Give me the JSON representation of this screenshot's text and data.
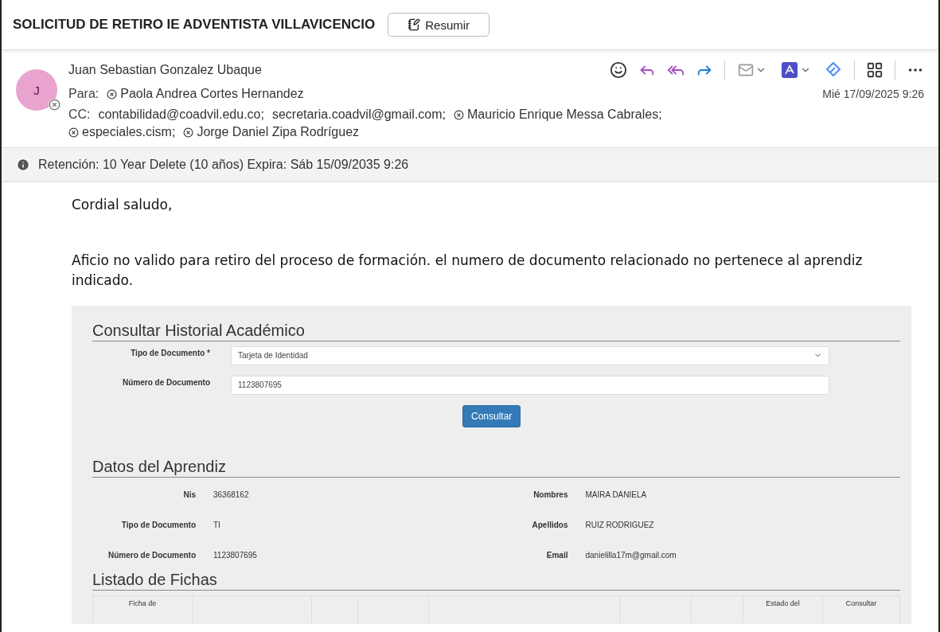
{
  "subject": {
    "title": "SOLICITUD DE RETIRO IE ADVENTISTA VILLAVICENCIO",
    "summarize_button": "Resumir"
  },
  "message": {
    "avatar_initial": "J",
    "sender": "Juan Sebastian Gonzalez Ubaque",
    "to_label": "Para:",
    "to": [
      {
        "name": "Paola Andrea Cortes Hernandez",
        "kind": "contact"
      }
    ],
    "date": "Mié 17/09/2025 9:26",
    "cc_label": "CC:",
    "cc": [
      {
        "name": "contabilidad@coadvil.edu.co;",
        "kind": "address"
      },
      {
        "name": "secretaria.coadvil@gmail.com;",
        "kind": "address"
      },
      {
        "name": "Mauricio Enrique Messa Cabrales;",
        "kind": "contact"
      },
      {
        "name": "especiales.cism;",
        "kind": "contact"
      },
      {
        "name": "Jorge Daniel Zipa Rodríguez",
        "kind": "contact"
      }
    ]
  },
  "retention": "Retención: 10 Year Delete (10 años) Expira: Sáb 15/09/2035 9:26",
  "body": {
    "greeting": "Cordial saludo,",
    "paragraph": "Aficio no valido para retiro del proceso de formación. el numero de documento relacionado no pertenece al aprendiz indicado."
  },
  "embedded_form": {
    "title": "Consultar Historial Académico",
    "fields": [
      {
        "label": "Tipo de Documento *",
        "value": "Tarjeta de Identidad",
        "kind": "select"
      },
      {
        "label": "Número de Documento",
        "value": "1123807695",
        "kind": "text"
      }
    ],
    "button": "Consultar",
    "learner_title": "Datos del Aprendiz",
    "learner_left": [
      {
        "label": "Nis",
        "value": "36368162"
      },
      {
        "label": "Tipo de Documento",
        "value": "TI"
      },
      {
        "label": "Número de Documento",
        "value": "1123807695"
      }
    ],
    "learner_right": [
      {
        "label": "Nombres",
        "value": "MAIRA DANIELA"
      },
      {
        "label": "Apellidos",
        "value": "RUIZ RODRIGUEZ"
      },
      {
        "label": "Email",
        "value": "danielilla17m@gmail.com"
      }
    ],
    "list_title": "Listado de Fichas",
    "table_columns": [
      "Ficha de",
      "",
      "",
      "",
      "",
      "",
      "",
      "Estado del",
      "Consultar"
    ]
  }
}
